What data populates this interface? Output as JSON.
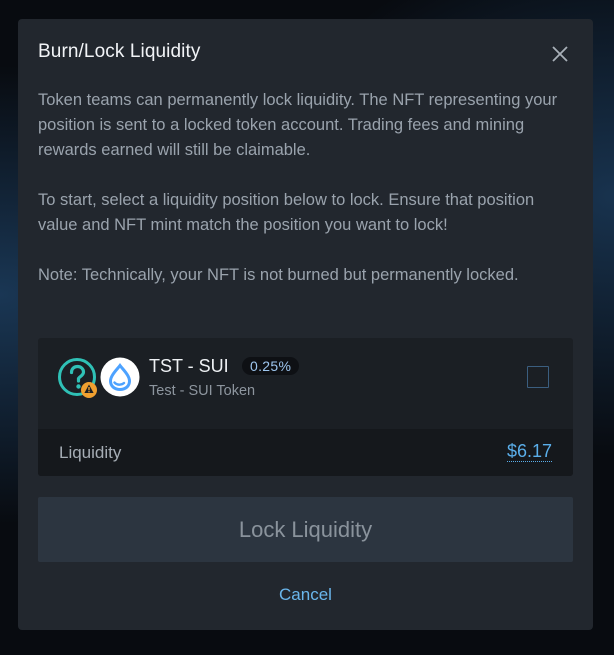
{
  "modal": {
    "title": "Burn/Lock Liquidity",
    "paragraphs": [
      "Token teams can permanently lock liquidity. The NFT representing your position is sent to a locked token account. Trading fees and mining rewards earned will still be claimable.",
      "To start, select a liquidity position below to lock. Ensure that position value and NFT mint match the position you want to lock!",
      "Note: Technically, your NFT is not burned but permanently locked."
    ]
  },
  "position": {
    "pair": "TST - SUI",
    "fee_tier": "0.25%",
    "name": "Test - SUI Token",
    "token_a_icon": "unknown-token-icon",
    "token_a_warning_icon": "warning-icon",
    "token_b_icon": "sui-droplet-icon",
    "selected": false,
    "liquidity_label": "Liquidity",
    "liquidity_value": "$6.17"
  },
  "actions": {
    "lock_label": "Lock Liquidity",
    "cancel_label": "Cancel"
  },
  "colors": {
    "accent": "#5aaeea",
    "teal": "#2fc1b6",
    "warning": "#f0a030",
    "sui_blue": "#4da2ff"
  }
}
